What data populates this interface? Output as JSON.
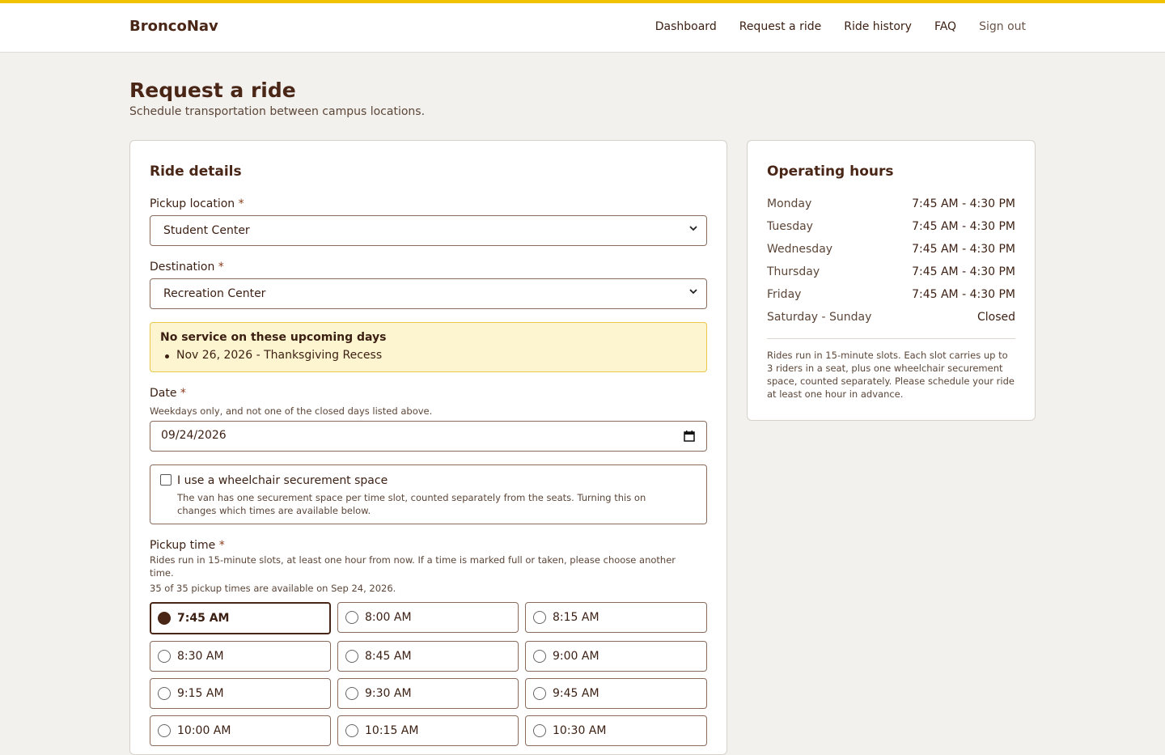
{
  "brand": "BroncoNav",
  "nav": [
    "Dashboard",
    "Request a ride",
    "Ride history",
    "FAQ",
    "Sign out"
  ],
  "page": {
    "title": "Request a ride",
    "subtitle": "Schedule transportation between campus locations."
  },
  "form": {
    "heading": "Ride details",
    "pickup_label": "Pickup location",
    "pickup_value": "Student Center",
    "destination_label": "Destination",
    "destination_value": "Recreation Center",
    "required_mark": "*",
    "alert_title": "No service on these upcoming days",
    "alert_item": "Nov 26, 2026 - Thanksgiving Recess",
    "date_label": "Date",
    "date_hint": "Weekdays only, and not one of the closed days listed above.",
    "date_value": "09/24/2026",
    "wheelchair_label": "I use a wheelchair securement space",
    "wheelchair_desc": "The van has one securement space per time slot, counted separately from the seats. Turning this on changes which times are available below.",
    "wheelchair_checked": false,
    "time_label": "Pickup time",
    "time_hint": "Rides run in 15-minute slots, at least one hour from now. If a time is marked full or taken, please choose another time.",
    "availability": "35 of 35 pickup times are available on Sep 24, 2026.",
    "selected_time": "7:45 AM",
    "times": [
      "7:45 AM",
      "8:00 AM",
      "8:15 AM",
      "8:30 AM",
      "8:45 AM",
      "9:00 AM",
      "9:15 AM",
      "9:30 AM",
      "9:45 AM",
      "10:00 AM",
      "10:15 AM",
      "10:30 AM"
    ]
  },
  "hours": {
    "heading": "Operating hours",
    "rows": [
      {
        "day": "Monday",
        "time": "7:45 AM - 4:30 PM"
      },
      {
        "day": "Tuesday",
        "time": "7:45 AM - 4:30 PM"
      },
      {
        "day": "Wednesday",
        "time": "7:45 AM - 4:30 PM"
      },
      {
        "day": "Thursday",
        "time": "7:45 AM - 4:30 PM"
      },
      {
        "day": "Friday",
        "time": "7:45 AM - 4:30 PM"
      },
      {
        "day": "Saturday - Sunday",
        "time": "Closed"
      }
    ],
    "note": "Rides run in 15-minute slots. Each slot carries up to 3 riders in a seat, plus one wheelchair securement space, counted separately. Please schedule your ride at least one hour in advance."
  },
  "colors": {
    "accent": "#f2c200",
    "brand": "#4a2617",
    "alert_bg": "#fdf5cf"
  }
}
